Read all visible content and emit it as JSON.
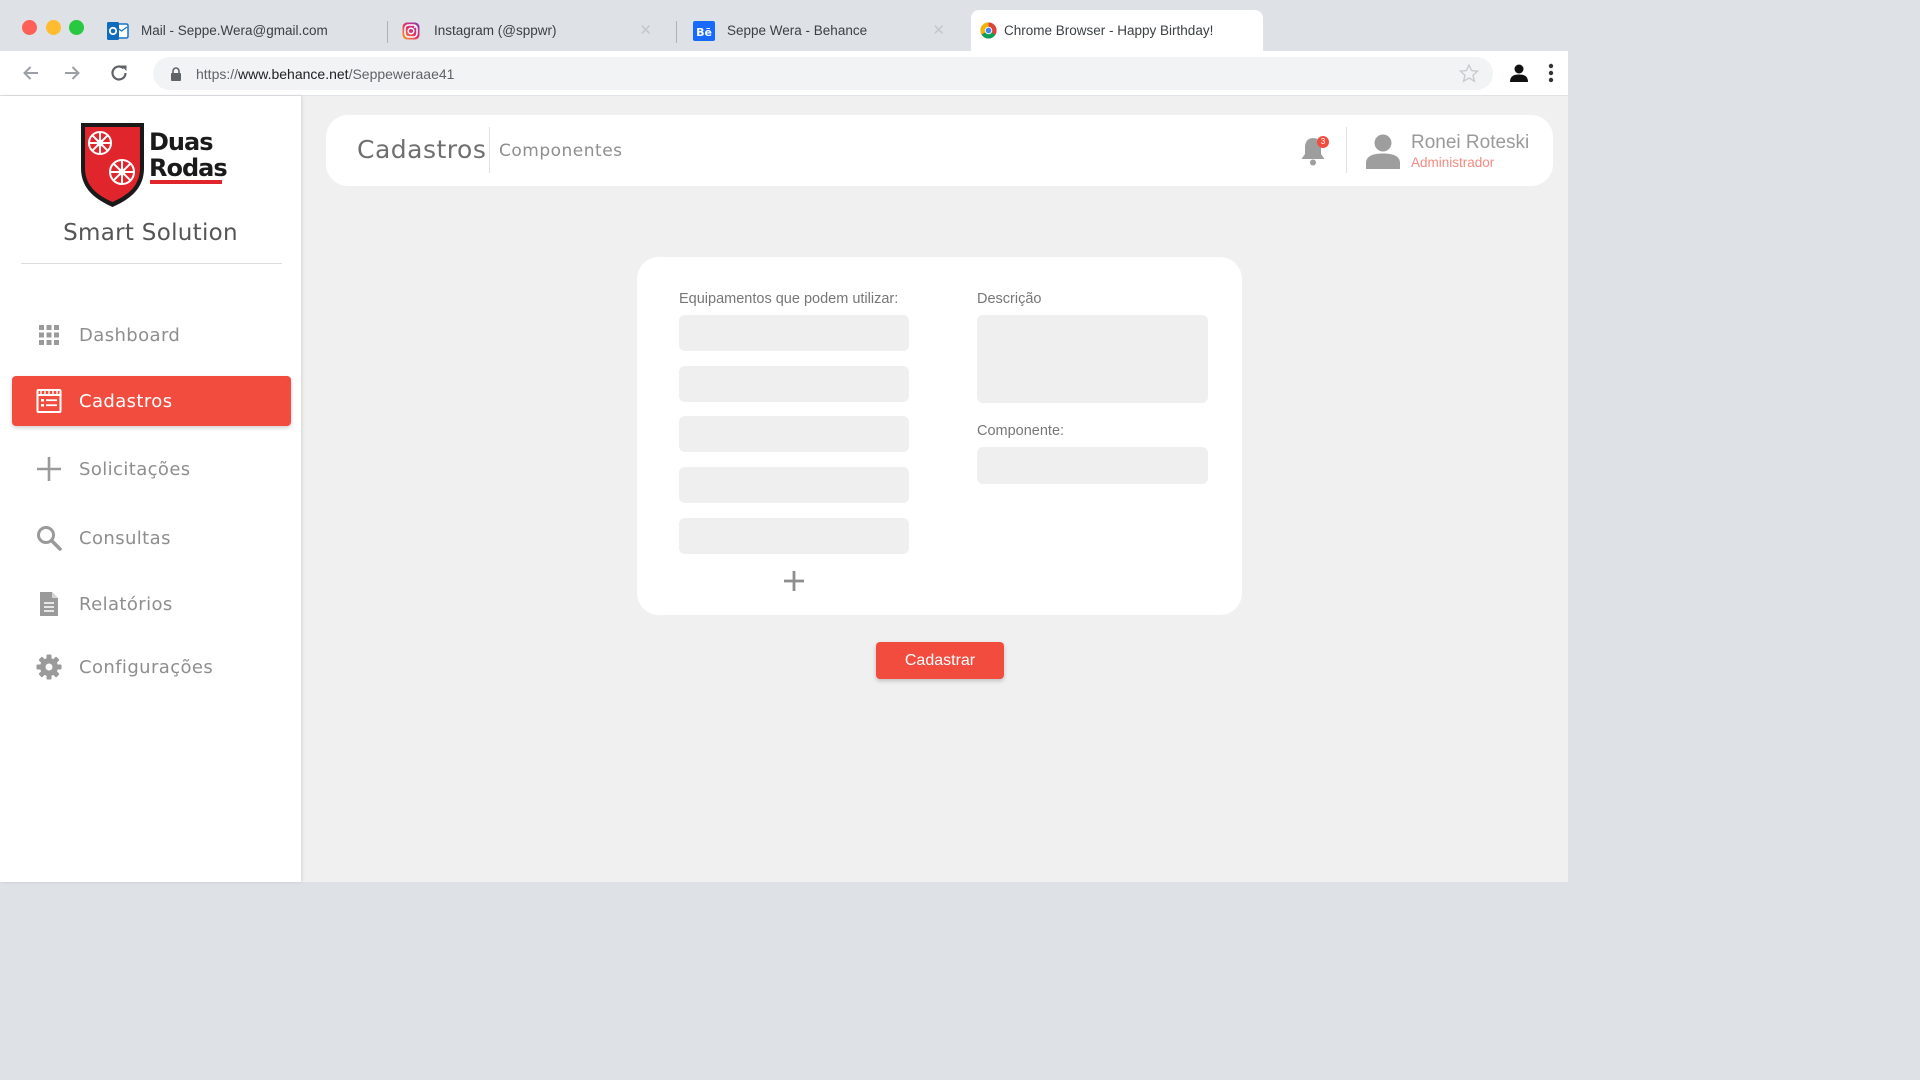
{
  "browser": {
    "tabs": [
      {
        "label": "Mail - Seppe.Wera@gmail.com",
        "icon": "outlook-icon",
        "active": false
      },
      {
        "label": "Instagram (@sppwr)",
        "icon": "instagram-icon",
        "active": false
      },
      {
        "label": "Seppe Wera - Behance",
        "icon": "behance-icon",
        "active": false
      },
      {
        "label": "Chrome Browser - Happy Birthday!",
        "icon": "chrome-icon",
        "active": true
      }
    ],
    "url": {
      "prefix": "https://",
      "domain": "www.behance.net",
      "path": "/Seppeweraae41"
    }
  },
  "sidebar": {
    "logo": {
      "line1": "Duas",
      "line2": "Rodas"
    },
    "app_name": "Smart Solution",
    "items": [
      {
        "label": "Dashboard",
        "icon": "grid-icon",
        "active": false
      },
      {
        "label": "Cadastros",
        "icon": "register-icon",
        "active": true
      },
      {
        "label": "Solicitações",
        "icon": "plus-icon",
        "active": false
      },
      {
        "label": "Consultas",
        "icon": "search-icon",
        "active": false
      },
      {
        "label": "Relatórios",
        "icon": "document-icon",
        "active": false
      },
      {
        "label": "Configurações",
        "icon": "gear-icon",
        "active": false
      }
    ]
  },
  "header": {
    "title": "Cadastros",
    "subtitle": "Componentes",
    "notifications": "3",
    "user": {
      "name": "Ronei Roteski",
      "role": "Administrador"
    }
  },
  "form": {
    "equipment_label": "Equipamentos que podem utilizar:",
    "description_label": "Descrição",
    "component_label": "Componente:",
    "submit_label": "Cadastrar"
  },
  "colors": {
    "accent": "#f24c3f",
    "role_text": "#f28b82"
  }
}
